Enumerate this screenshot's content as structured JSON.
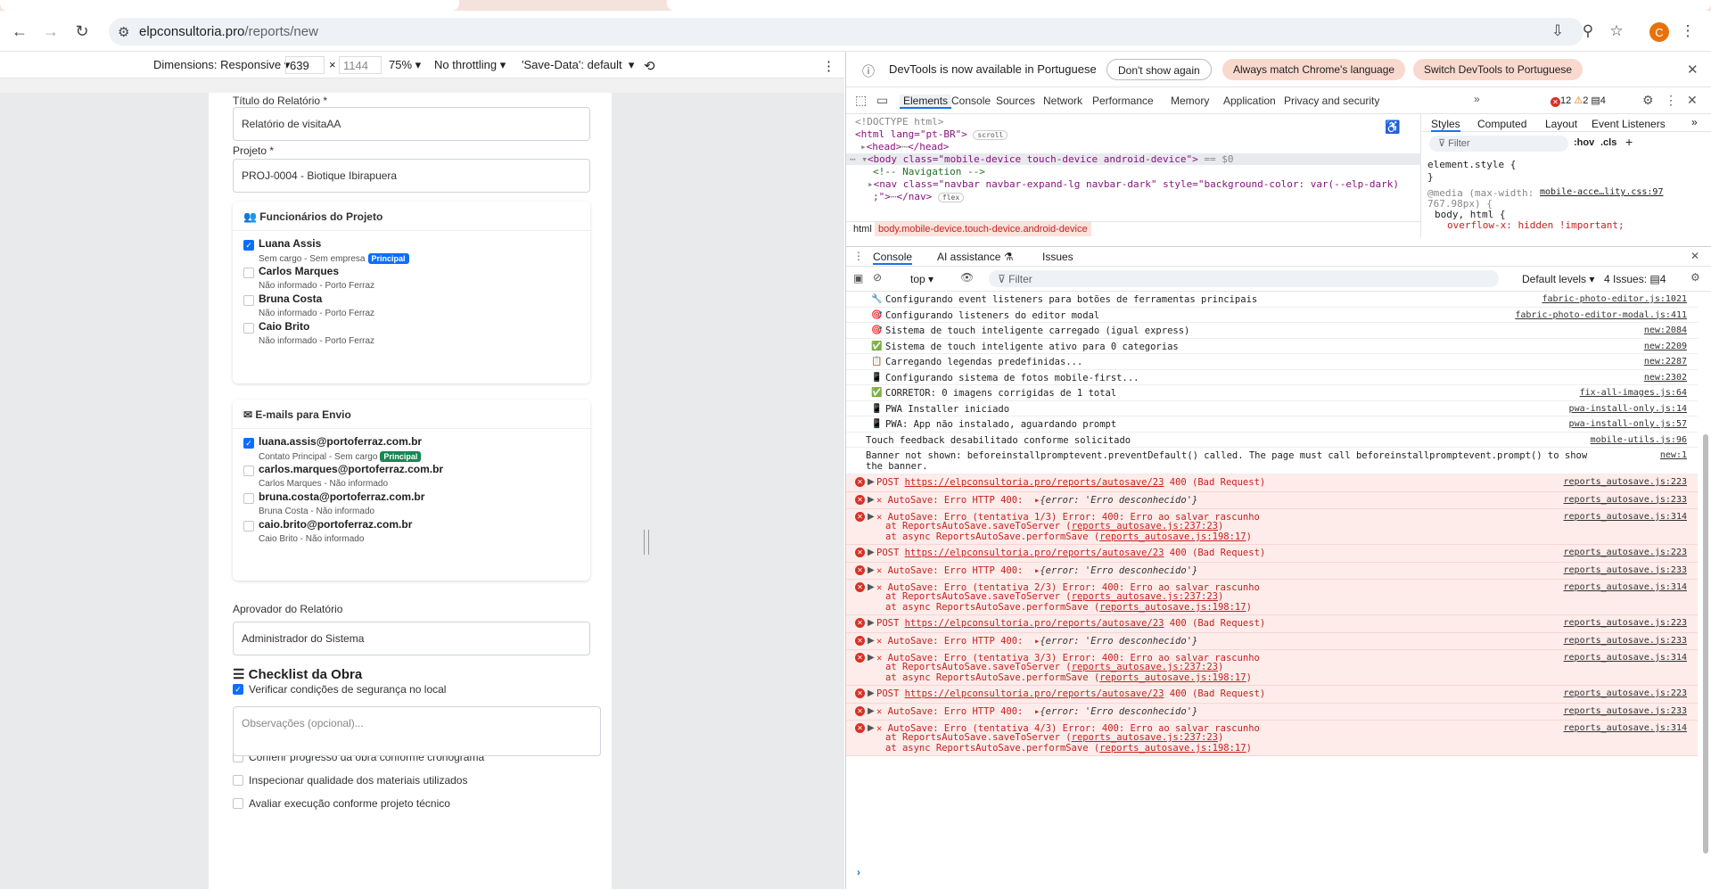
{
  "browser": {
    "url_host": "elpconsultoria.pro",
    "url_path": "/reports/new",
    "profile_initial": "C"
  },
  "device_toolbar": {
    "dimensions_label": "Dimensions: Responsive",
    "width_value": "639",
    "height_value": "1144",
    "zoom": "75%",
    "throttling": "No throttling",
    "save_data": "'Save-Data': default"
  },
  "form": {
    "title_label": "Título do Relatório *",
    "title_value": "Relatório de visitaAA",
    "project_label": "Projeto *",
    "project_value": "PROJ-0004 - Biotique Ibirapuera",
    "employees_header": "Funcionários do Projeto",
    "employees": [
      {
        "name": "Luana Assis",
        "sub": "Sem cargo - Sem empresa",
        "badge": "Principal",
        "checked": true
      },
      {
        "name": "Carlos Marques",
        "sub": "Não informado - Porto Ferraz",
        "badge": "",
        "checked": false
      },
      {
        "name": "Bruna Costa",
        "sub": "Não informado - Porto Ferraz",
        "badge": "",
        "checked": false
      },
      {
        "name": "Caio Brito",
        "sub": "Não informado - Porto Ferraz",
        "badge": "",
        "checked": false
      }
    ],
    "emails_header": "E-mails para Envio",
    "emails": [
      {
        "email": "luana.assis@portoferraz.com.br",
        "sub": "Contato Principal - Sem cargo",
        "badge": "Principal",
        "checked": true
      },
      {
        "email": "carlos.marques@portoferraz.com.br",
        "sub": "Carlos Marques - Não informado",
        "badge": "",
        "checked": false
      },
      {
        "email": "bruna.costa@portoferraz.com.br",
        "sub": "Bruna Costa - Não informado",
        "badge": "",
        "checked": false
      },
      {
        "email": "caio.brito@portoferraz.com.br",
        "sub": "Caio Brito - Não informado",
        "badge": "",
        "checked": false
      }
    ],
    "approver_label": "Aprovador do Relatório",
    "approver_value": "Administrador do Sistema",
    "checklist_title": "Checklist da Obra",
    "checklist": [
      {
        "label": "Verificar condições de segurança no local",
        "checked": true
      },
      {
        "label": "Conferir progresso da obra conforme cronograma",
        "checked": false
      },
      {
        "label": "Inspecionar qualidade dos materiais utilizados",
        "checked": false
      },
      {
        "label": "Avaliar execução conforme projeto técnico",
        "checked": false
      }
    ],
    "obs_placeholder": "Observações (opcional)...",
    "badge_blue": "#0d6efd",
    "badge_green": "#198754"
  },
  "devtools": {
    "infobar_msg": "DevTools is now available in Portuguese",
    "btn_dont_show": "Don't show again",
    "btn_always_match": "Always match Chrome's language",
    "btn_switch": "Switch DevTools to Portuguese",
    "tabs": [
      "Elements",
      "Console",
      "Sources",
      "Network",
      "Performance",
      "Memory",
      "Application",
      "Privacy and security"
    ],
    "error_count": "12",
    "warn_count": "2",
    "issue_count": "4",
    "elements": {
      "doctype": "<!DOCTYPE html>",
      "html_open": "<html lang=\"pt-BR\">",
      "scroll_badge": "scroll",
      "head": "<head>",
      "head_close": "</head>",
      "body_tag": "<body class=\"mobile-device touch-device android-device\">",
      "body_eq": "== $0",
      "comment": "<!-- Navigation -->",
      "nav_tag": "<nav class=\"navbar navbar-expand-lg navbar-dark\" style=\"background-color: var(--elp-dark)",
      "nav_close": ";\">",
      "nav_end": "</nav>",
      "flex_badge": "flex"
    },
    "crumbs": [
      "html",
      "body.mobile-device.touch-device.android-device"
    ],
    "styles_tabs": [
      "Styles",
      "Computed",
      "Layout",
      "Event Listeners"
    ],
    "styles_filter": "Filter",
    "styles_hov": ":hov",
    "styles_cls": ".cls",
    "style_rule1": "element.style {",
    "style_rule1_end": "}",
    "style_media": "@media (max-width:",
    "style_media2": "767.98px) {",
    "style_media_src": "mobile-acce…lity.css:97",
    "style_sel": "body, html {",
    "style_prop": "overflow-x: hidden !important;",
    "drawer_tabs": [
      "Console",
      "AI assistance",
      "Issues"
    ],
    "console_context": "top",
    "console_filter": "Filter",
    "default_levels": "Default levels",
    "issues_label": "4 Issues:",
    "issues_count": "4"
  },
  "console_logs": [
    {
      "type": "log",
      "icon": "🔧",
      "text": "Configurando event listeners para botões de ferramentas principais",
      "src": "fabric-photo-editor.js:1021"
    },
    {
      "type": "log",
      "icon": "🎯",
      "text": "Configurando listeners do editor modal",
      "src": "fabric-photo-editor-modal.js:411"
    },
    {
      "type": "log",
      "icon": "🎯",
      "text": "Sistema de touch inteligente carregado (igual express)",
      "src": "new:2084"
    },
    {
      "type": "log",
      "icon": "✅",
      "text": "Sistema de touch inteligente ativo para 0 categorias",
      "src": "new:2209"
    },
    {
      "type": "log",
      "icon": "📋",
      "text": "Carregando legendas predefinidas...",
      "src": "new:2287"
    },
    {
      "type": "log",
      "icon": "📱",
      "text": "Configurando sistema de fotos mobile-first...",
      "src": "new:2302"
    },
    {
      "type": "log",
      "icon": "✅",
      "text": "CORRETOR: 0 imagens corrigidas de 1 total",
      "src": "fix-all-images.js:64"
    },
    {
      "type": "log",
      "icon": "📱",
      "text": "PWA Installer iniciado",
      "src": "pwa-install-only.js:14"
    },
    {
      "type": "log",
      "icon": "📱",
      "text": "PWA: App não instalado, aguardando prompt",
      "src": "pwa-install-only.js:57"
    },
    {
      "type": "plain",
      "icon": "",
      "text": "Touch feedback desabilitado conforme solicitado",
      "src": "mobile-utils.js:96"
    },
    {
      "type": "plain2",
      "icon": "",
      "text": "Banner not shown: beforeinstallpromptevent.preventDefault() called. The page must call beforeinstallpromptevent.prompt() to show",
      "text2": "the banner.",
      "src": "new:1"
    }
  ],
  "console_errors": [
    {
      "kind": "post",
      "text": "POST",
      "link": "https://elpconsultoria.pro/reports/autosave/23",
      "status": "400 (Bad Request)",
      "src": "reports_autosave.js:223"
    },
    {
      "kind": "http",
      "text": "AutoSave: Erro HTTP 400:",
      "obj": "{error: 'Erro desconhecido'}",
      "src": "reports_autosave.js:233"
    },
    {
      "kind": "try",
      "text": "AutoSave: Erro (tentativa 1/3) Error: 400: Erro ao salvar rascunho",
      "l2": "at ReportsAutoSave.saveToServer (",
      "l2link": "reports_autosave.js:237:23",
      "l3": "at async ReportsAutoSave.performSave (",
      "l3link": "reports_autosave.js:198:17",
      "src": "reports_autosave.js:314"
    },
    {
      "kind": "post",
      "text": "POST",
      "link": "https://elpconsultoria.pro/reports/autosave/23",
      "status": "400 (Bad Request)",
      "src": "reports_autosave.js:223"
    },
    {
      "kind": "http",
      "text": "AutoSave: Erro HTTP 400:",
      "obj": "{error: 'Erro desconhecido'}",
      "src": "reports_autosave.js:233"
    },
    {
      "kind": "try",
      "text": "AutoSave: Erro (tentativa 2/3) Error: 400: Erro ao salvar rascunho",
      "l2": "at ReportsAutoSave.saveToServer (",
      "l2link": "reports_autosave.js:237:23",
      "l3": "at async ReportsAutoSave.performSave (",
      "l3link": "reports_autosave.js:198:17",
      "src": "reports_autosave.js:314"
    },
    {
      "kind": "post",
      "text": "POST",
      "link": "https://elpconsultoria.pro/reports/autosave/23",
      "status": "400 (Bad Request)",
      "src": "reports_autosave.js:223"
    },
    {
      "kind": "http",
      "text": "AutoSave: Erro HTTP 400:",
      "obj": "{error: 'Erro desconhecido'}",
      "src": "reports_autosave.js:233"
    },
    {
      "kind": "try",
      "text": "AutoSave: Erro (tentativa 3/3) Error: 400: Erro ao salvar rascunho",
      "l2": "at ReportsAutoSave.saveToServer (",
      "l2link": "reports_autosave.js:237:23",
      "l3": "at async ReportsAutoSave.performSave (",
      "l3link": "reports_autosave.js:198:17",
      "src": "reports_autosave.js:314"
    },
    {
      "kind": "post",
      "text": "POST",
      "link": "https://elpconsultoria.pro/reports/autosave/23",
      "status": "400 (Bad Request)",
      "src": "reports_autosave.js:223"
    },
    {
      "kind": "http",
      "text": "AutoSave: Erro HTTP 400:",
      "obj": "{error: 'Erro desconhecido'}",
      "src": "reports_autosave.js:233"
    },
    {
      "kind": "try",
      "text": "AutoSave: Erro (tentativa 4/3) Error: 400: Erro ao salvar rascunho",
      "l2": "at ReportsAutoSave.saveToServer (",
      "l2link": "reports_autosave.js:237:23",
      "l3": "at async ReportsAutoSave.performSave (",
      "l3link": "reports_autosave.js:198:17",
      "src": "reports_autosave.js:314"
    }
  ],
  "colors": {
    "accent_blue": "#1a73e8",
    "error_red": "#d93025",
    "error_bg": "#fdecea"
  }
}
